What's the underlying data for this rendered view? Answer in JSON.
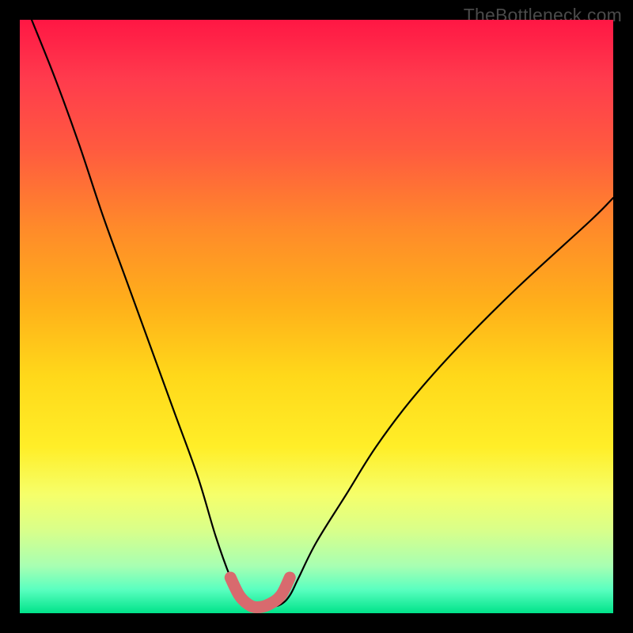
{
  "watermark": "TheBottleneck.com",
  "chart_data": {
    "type": "line",
    "title": "",
    "xlabel": "",
    "ylabel": "",
    "xlim": [
      0,
      100
    ],
    "ylim": [
      0,
      100
    ],
    "series": [
      {
        "name": "bottleneck-curve",
        "x": [
          2,
          6,
          10,
          14,
          18,
          22,
          26,
          30,
          33,
          35.5,
          37,
          38.5,
          40,
          42,
          44,
          45.5,
          47,
          50,
          55,
          60,
          66,
          74,
          84,
          96,
          100
        ],
        "values": [
          100,
          90,
          79,
          67,
          56,
          45,
          34,
          23,
          13,
          6,
          3,
          1.5,
          1,
          1,
          1.5,
          3,
          6,
          12,
          20,
          28,
          36,
          45,
          55,
          66,
          70
        ]
      }
    ],
    "trough_marker": {
      "x": [
        35.5,
        37,
        38.5,
        40,
        42,
        44,
        45.5
      ],
      "values": [
        6,
        3,
        1.5,
        1,
        1.5,
        3,
        6
      ],
      "color": "#d86a6e"
    },
    "gradient_meaning": "top = high bottleneck (red), bottom = low bottleneck (green)"
  }
}
